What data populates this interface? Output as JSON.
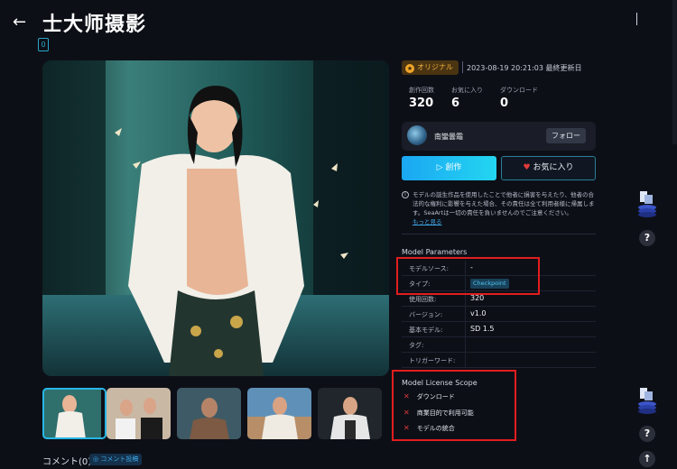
{
  "header": {
    "title": "士大师摄影",
    "back_icon": "arrow-left-icon",
    "badge": "0"
  },
  "meta": {
    "original_label": "オリジナル",
    "updated": "2023-08-19 20:21:03 最終更新日"
  },
  "stats": [
    {
      "label": "創作回数",
      "value": "320"
    },
    {
      "label": "お気に入り",
      "value": "6"
    },
    {
      "label": "ダウンロード",
      "value": "0"
    }
  ],
  "author": {
    "name": "南蠻曇霜",
    "follow_label": "フォロー"
  },
  "actions": {
    "create_label": "▷ 創作",
    "favorite_label": "お気に入り"
  },
  "notice": {
    "text": "モデルの誕生作品を使用したことで他者に損害を与えたり、他者の合法的な権利に影響を与えた場合、その責任は全て利用者様に帰属します。SeaArtは一切の責任を負いませんのでご注意ください。",
    "more": "もっと見る"
  },
  "params": {
    "title": "Model Parameters",
    "rows": [
      {
        "label": "モデルソース:",
        "value": "-"
      },
      {
        "label": "タイプ:",
        "value": "Checkpoint"
      },
      {
        "label": "使用回数:",
        "value": "320"
      },
      {
        "label": "バージョン:",
        "value": "v1.0"
      },
      {
        "label": "基本モデル:",
        "value": "SD 1.5"
      },
      {
        "label": "タグ:",
        "value": ""
      },
      {
        "label": "トリガーワード:",
        "value": ""
      }
    ]
  },
  "license": {
    "title": "Model License Scope",
    "items": [
      "ダウンロード",
      "商業目的で利用可能",
      "モデルの統合"
    ]
  },
  "comments": {
    "label": "コメント(0)",
    "post_label": "◎ コメント投稿"
  },
  "rail": {
    "help_label": "?",
    "up_label": "↑"
  }
}
